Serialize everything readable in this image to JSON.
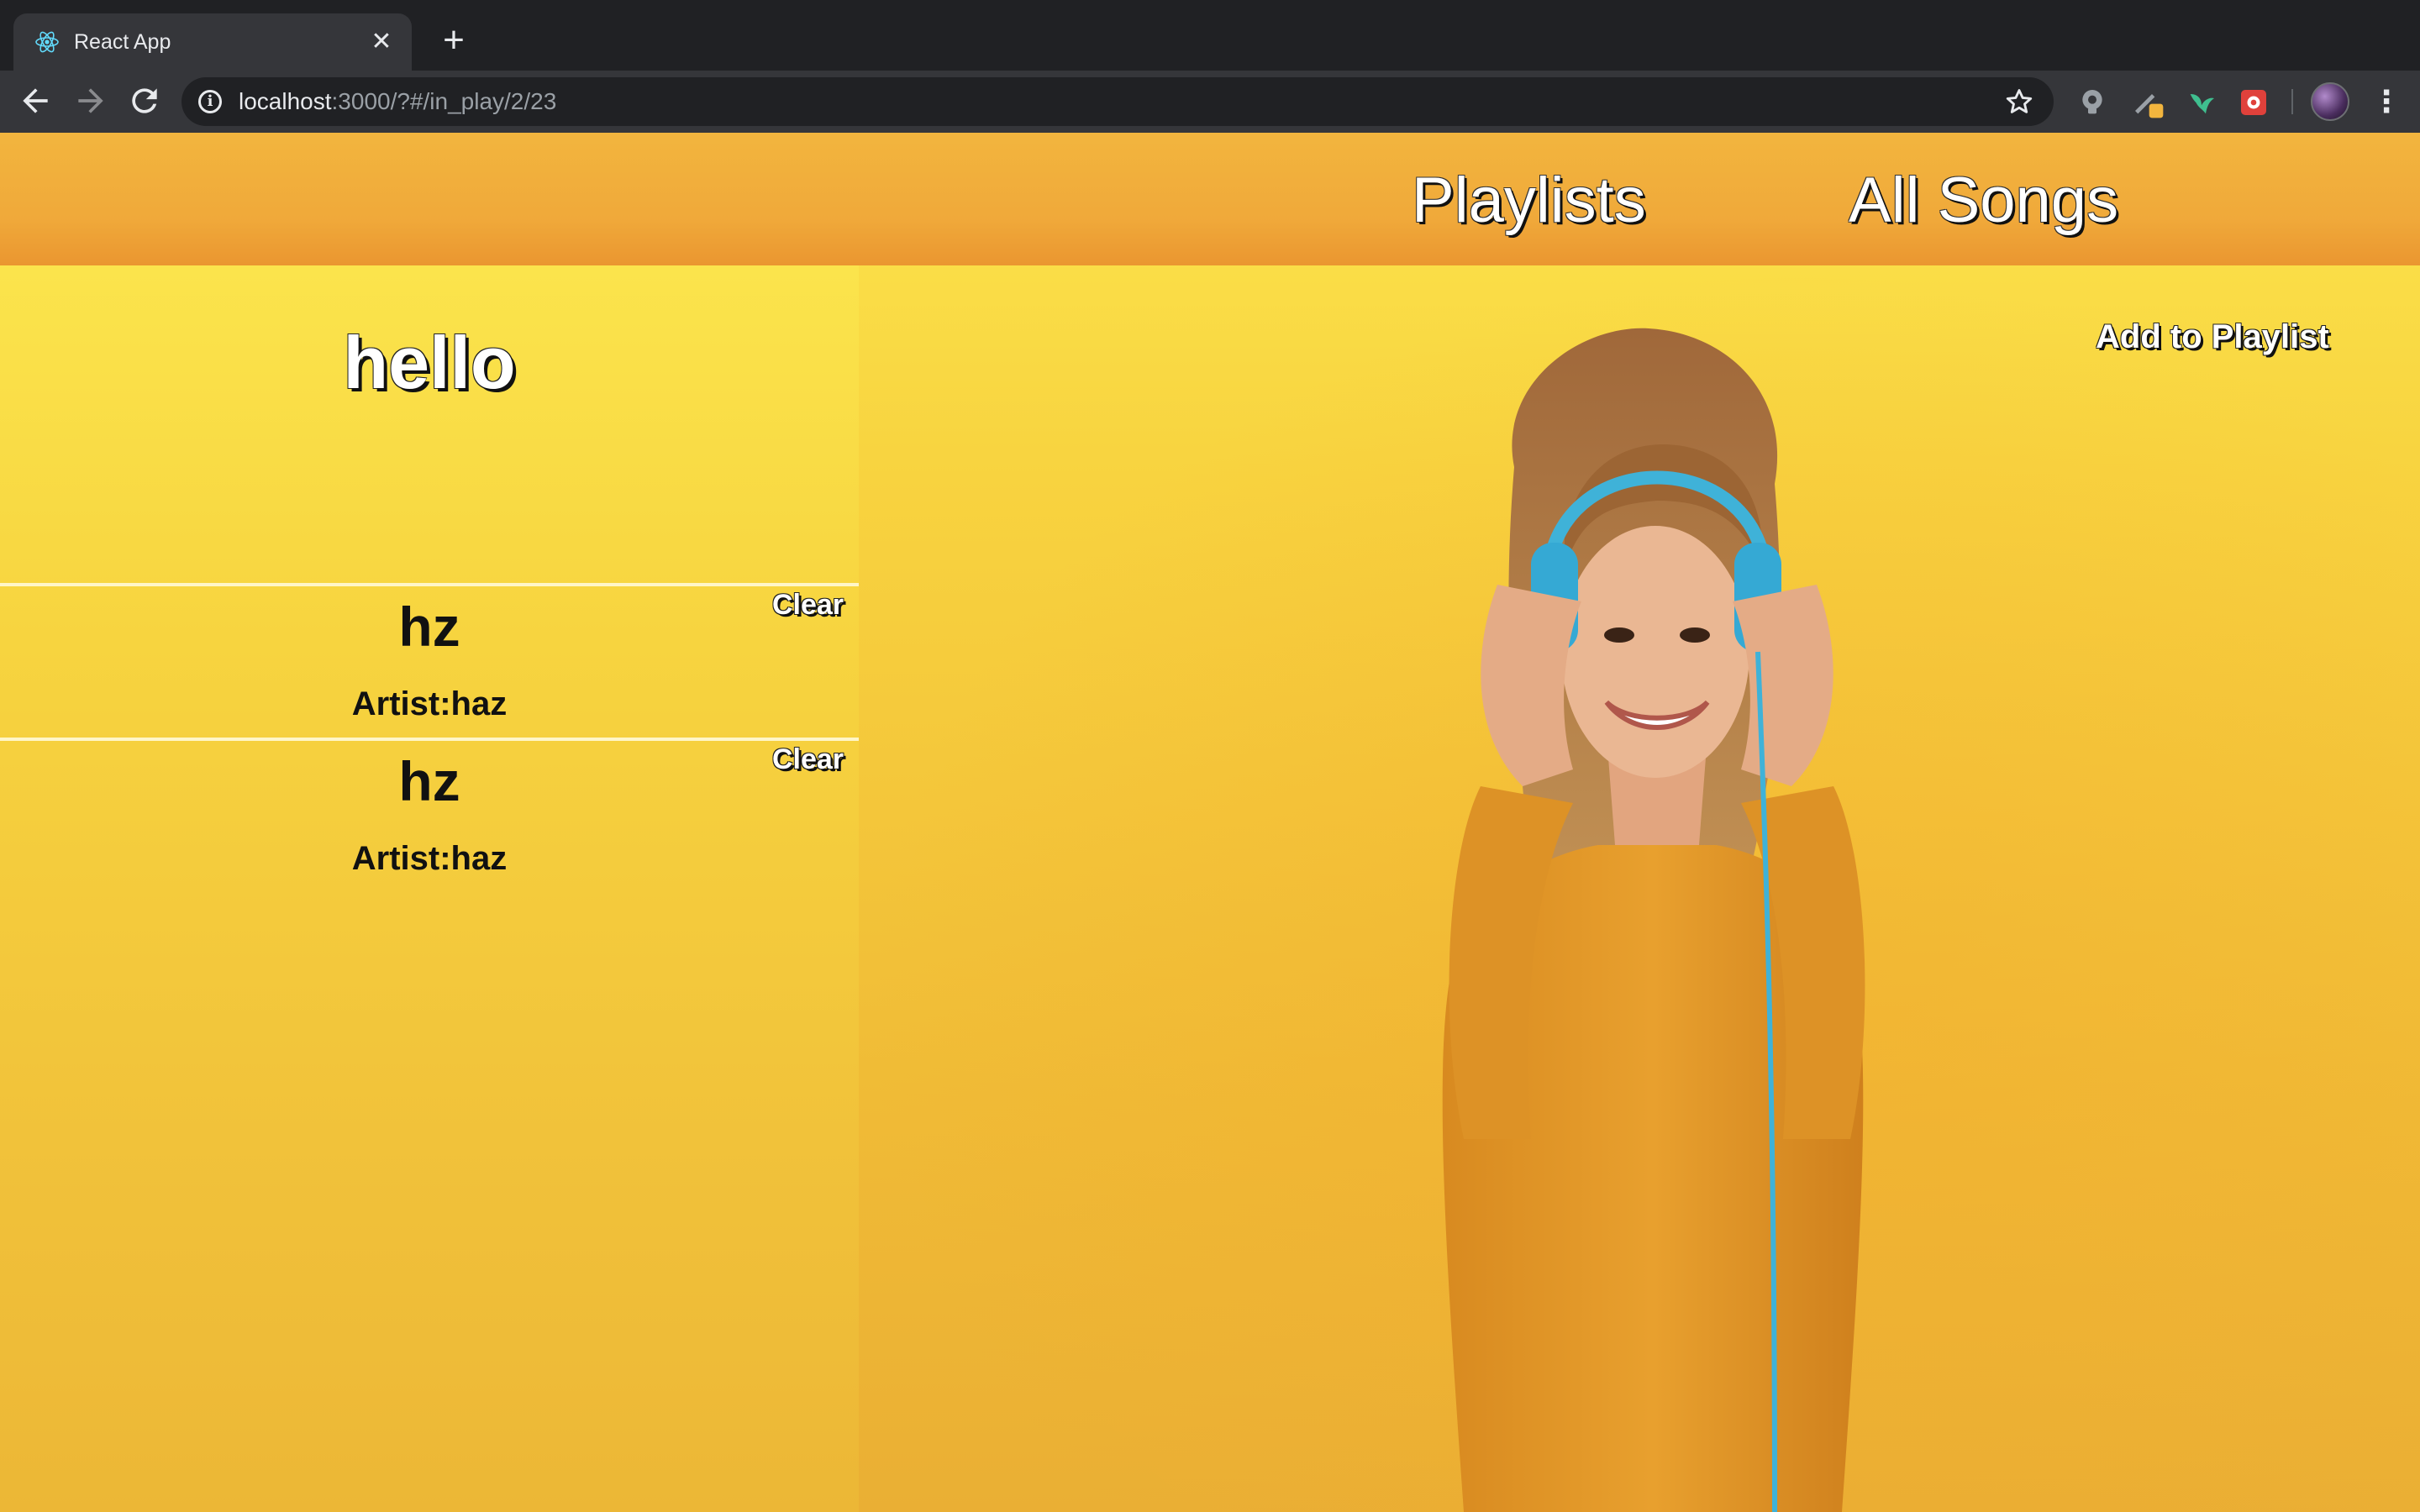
{
  "browser": {
    "tab_title": "React App",
    "tab_close_glyph": "✕",
    "new_tab_glyph": "+",
    "url_host": "localhost",
    "url_rest": ":3000/?#/in_play/2/23",
    "icons": [
      "react-favicon",
      "back-arrow-icon",
      "forward-arrow-icon",
      "reload-icon",
      "info-icon",
      "bookmark-star-icon",
      "extension-icon",
      "avatar",
      "menu-icon"
    ]
  },
  "header": {
    "nav": [
      {
        "label": "Playlists"
      },
      {
        "label": "All Songs"
      }
    ]
  },
  "playlist": {
    "name": "hello",
    "songs": [
      {
        "title": "hz",
        "artist": "Artist:haz",
        "clear_label": "Clear"
      },
      {
        "title": "hz",
        "artist": "Artist:haz",
        "clear_label": "Clear"
      }
    ]
  },
  "main": {
    "add_to_playlist_label": "Add to Playlist"
  },
  "colors": {
    "header": "#f0a93a",
    "background": "#f8d33f",
    "chrome_dark": "#202124",
    "chrome_toolbar": "#35363a"
  }
}
